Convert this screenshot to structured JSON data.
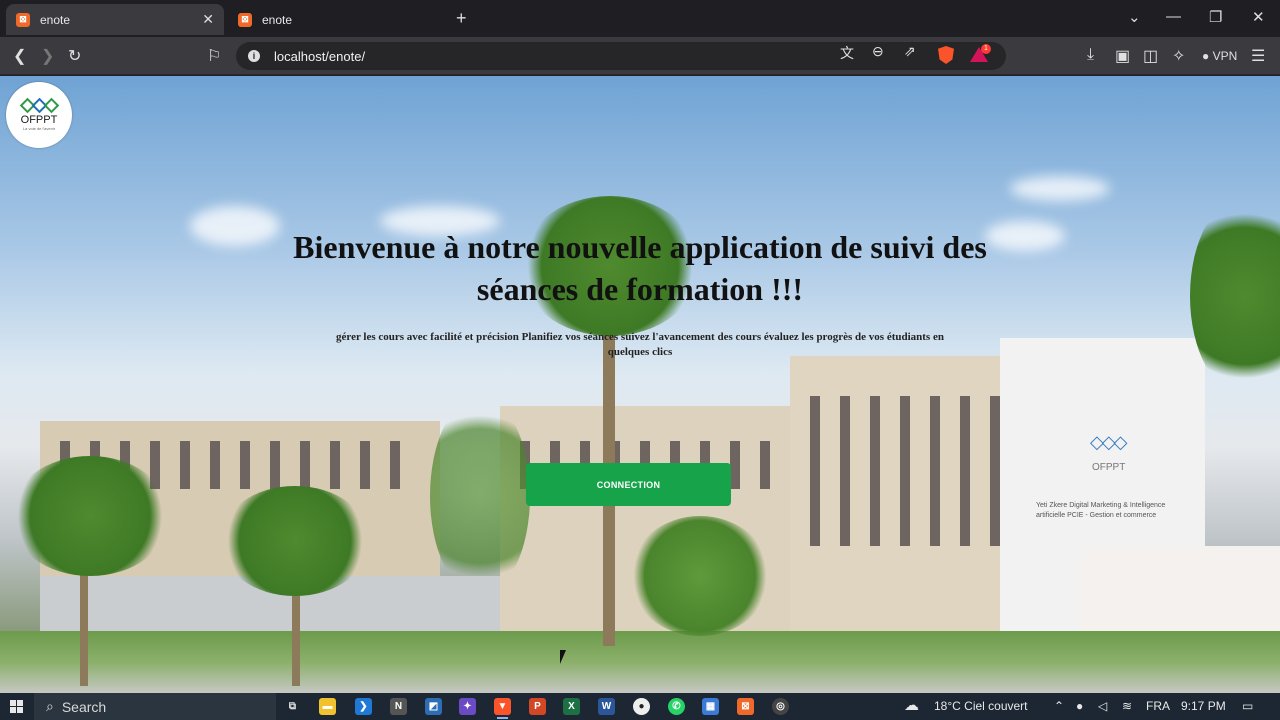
{
  "browser": {
    "tabs": [
      {
        "title": "enote",
        "favicon": "xampp-icon",
        "active": true
      },
      {
        "title": "enote",
        "favicon": "xampp-icon",
        "active": false
      }
    ],
    "new_tab": "+",
    "url": "localhost/enote/",
    "vpn_label": "VPN",
    "reward_badge": "1"
  },
  "page": {
    "logo_name": "OFPPT",
    "logo_tagline": "La voie de l'avenir",
    "hero_title": "Bienvenue à notre nouvelle application de suivi des séances de formation !!!",
    "hero_subtitle": "gérer les cours avec facilité et précision Planifiez vos séances suivez l'avancement des cours évaluez les progrès de vos étudiants en quelques clics",
    "connect_label": "CONNECTION",
    "building_logo": "OFPPT",
    "building_sign": "Yeti Zkere Digital Marketing & Intelligence artificielle PCIE - Gestion et commerce"
  },
  "taskbar": {
    "search_placeholder": "Search",
    "weather": "18°C Ciel couvert",
    "language": "FRA",
    "time": "9:17 PM"
  },
  "colors": {
    "connect_button": "#16a34a",
    "tab_favicon": "#ef6a2a",
    "brave_orange": "#fb542b"
  }
}
